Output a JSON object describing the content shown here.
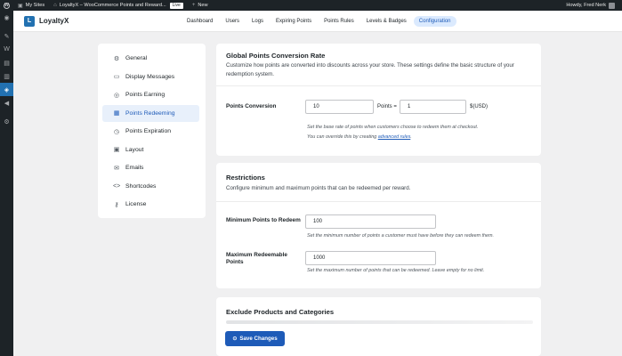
{
  "admin_bar": {
    "my_sites": "My Sites",
    "site_title": "LoyaltyX – WooCommerce Points and Reward...",
    "live_badge": "Live",
    "new_label": "New",
    "howdy": "Howdy, Fred Nerk"
  },
  "plugin": {
    "name": "LoyaltyX"
  },
  "tabs": [
    {
      "label": "Dashboard"
    },
    {
      "label": "Users"
    },
    {
      "label": "Logs"
    },
    {
      "label": "Expiring Points"
    },
    {
      "label": "Points Rules"
    },
    {
      "label": "Levels & Badges"
    },
    {
      "label": "Configuration"
    }
  ],
  "config_menu": [
    {
      "label": "General",
      "icon": "gear-icon"
    },
    {
      "label": "Display Messages",
      "icon": "chat-icon"
    },
    {
      "label": "Points Earning",
      "icon": "coins-icon"
    },
    {
      "label": "Points Redeeming",
      "icon": "gift-icon"
    },
    {
      "label": "Points Expiration",
      "icon": "clock-icon"
    },
    {
      "label": "Layout",
      "icon": "layout-icon"
    },
    {
      "label": "Emails",
      "icon": "mail-icon"
    },
    {
      "label": "Shortcodes",
      "icon": "code-icon"
    },
    {
      "label": "License",
      "icon": "key-icon"
    }
  ],
  "conversion": {
    "title": "Global Points Conversion Rate",
    "desc_line1": "Customize how points are converted into discounts across your store. These settings define the basic structure of your",
    "desc_line2": "redemption system.",
    "field_label": "Points Conversion",
    "points_value": "10",
    "points_suffix": "Points =",
    "currency_value": "1",
    "currency_suffix": "$(USD)",
    "help1": "Set the base rate of points when customers choose to redeem them at checkout.",
    "help2_prefix": "You can override this by creating",
    "help2_link": "advanced rules",
    "help2_suffix": "."
  },
  "restrictions": {
    "title": "Restrictions",
    "desc": "Configure minimum and maximum points that can be redeemed per reward.",
    "min_label": "Minimum Points to Redeem",
    "min_value": "100",
    "min_help": "Set the minimum number of points a customer must have before they can redeem them.",
    "max_label_line1": "Maximum Redeemable",
    "max_label_line2": "Points",
    "max_value": "1000",
    "max_help": "Set the maximum number of points that can be redeemed. Leave empty for no limit."
  },
  "exclude": {
    "title": "Exclude Products and Categories"
  },
  "save_button": "Save Changes",
  "colors": {
    "accent": "#1e5bb8",
    "admin_bar": "#1d2327",
    "active_tab_bg": "#dbeafe"
  }
}
